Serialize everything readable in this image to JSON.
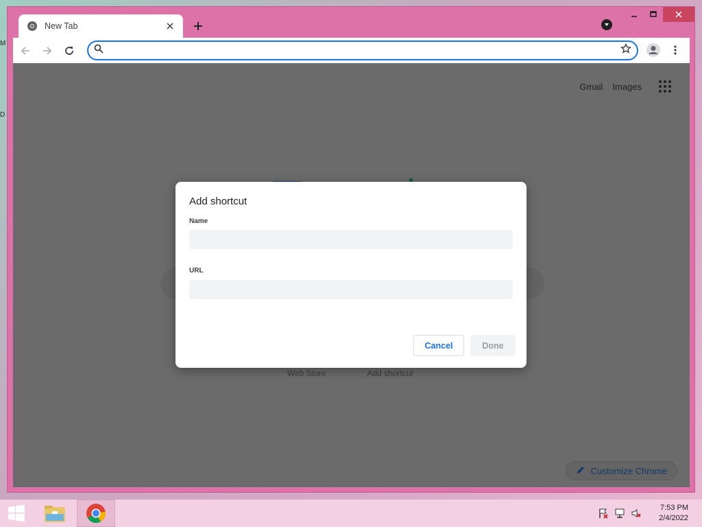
{
  "desktop": {
    "edge_letters": [
      "M",
      "D"
    ]
  },
  "browser": {
    "tab": {
      "title": "New Tab"
    },
    "omnibox": {
      "value": "",
      "placeholder": ""
    }
  },
  "page": {
    "top_links": [
      "Gmail",
      "Images"
    ],
    "shortcut_labels": [
      "Web Store",
      "Add shortcut"
    ],
    "customize_label": "Customize Chrome"
  },
  "dialog": {
    "title": "Add shortcut",
    "name_label": "Name",
    "name_value": "",
    "url_label": "URL",
    "url_value": "",
    "cancel_label": "Cancel",
    "done_label": "Done"
  },
  "taskbar": {
    "time": "7:53 PM",
    "date": "2/4/2022"
  },
  "colors": {
    "window_frame": "#dd72a8",
    "accent_blue": "#1a73e8",
    "overlay": "#6b6b6b",
    "taskbar": "#f3d0e2"
  }
}
